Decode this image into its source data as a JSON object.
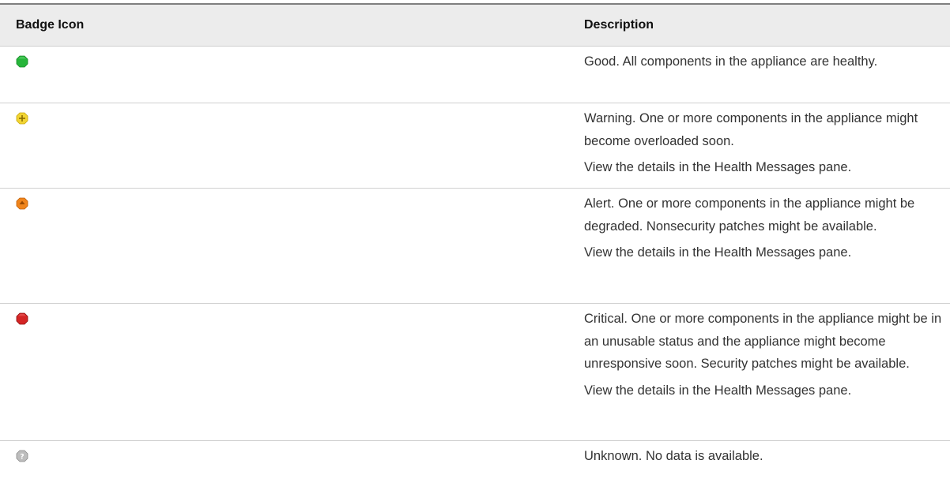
{
  "table": {
    "headers": {
      "icon": "Badge Icon",
      "description": "Description"
    },
    "rows": [
      {
        "icon": "green-health-badge-icon",
        "paragraphs": [
          "Good. All components in the appliance are healthy."
        ]
      },
      {
        "icon": "yellow-health-badge-icon",
        "paragraphs": [
          "Warning. One or more components in the appliance might become overloaded soon.",
          "View the details in the Health Messages pane."
        ]
      },
      {
        "icon": "orange-health-badge-icon",
        "paragraphs": [
          "Alert. One or more components in the appliance might be degraded. Nonsecurity patches might be available.",
          "View the details in the Health Messages pane."
        ]
      },
      {
        "icon": "red-health-badge-icon",
        "paragraphs": [
          "Critical. One or more components in the appliance might be in an unusable status and the appliance might become unresponsive soon. Security patches might be available.",
          "View the details in the Health Messages pane."
        ]
      },
      {
        "icon": "gray-unknown-badge-icon",
        "paragraphs": [
          "Unknown. No data is available."
        ]
      }
    ]
  },
  "colors": {
    "good": "#26b53a",
    "warning": "#f2d533",
    "alert": "#f0851c",
    "critical": "#d42525",
    "unknown": "#bdbdbd",
    "header_bg": "#ececec",
    "row_divider": "#d0d0d0"
  }
}
